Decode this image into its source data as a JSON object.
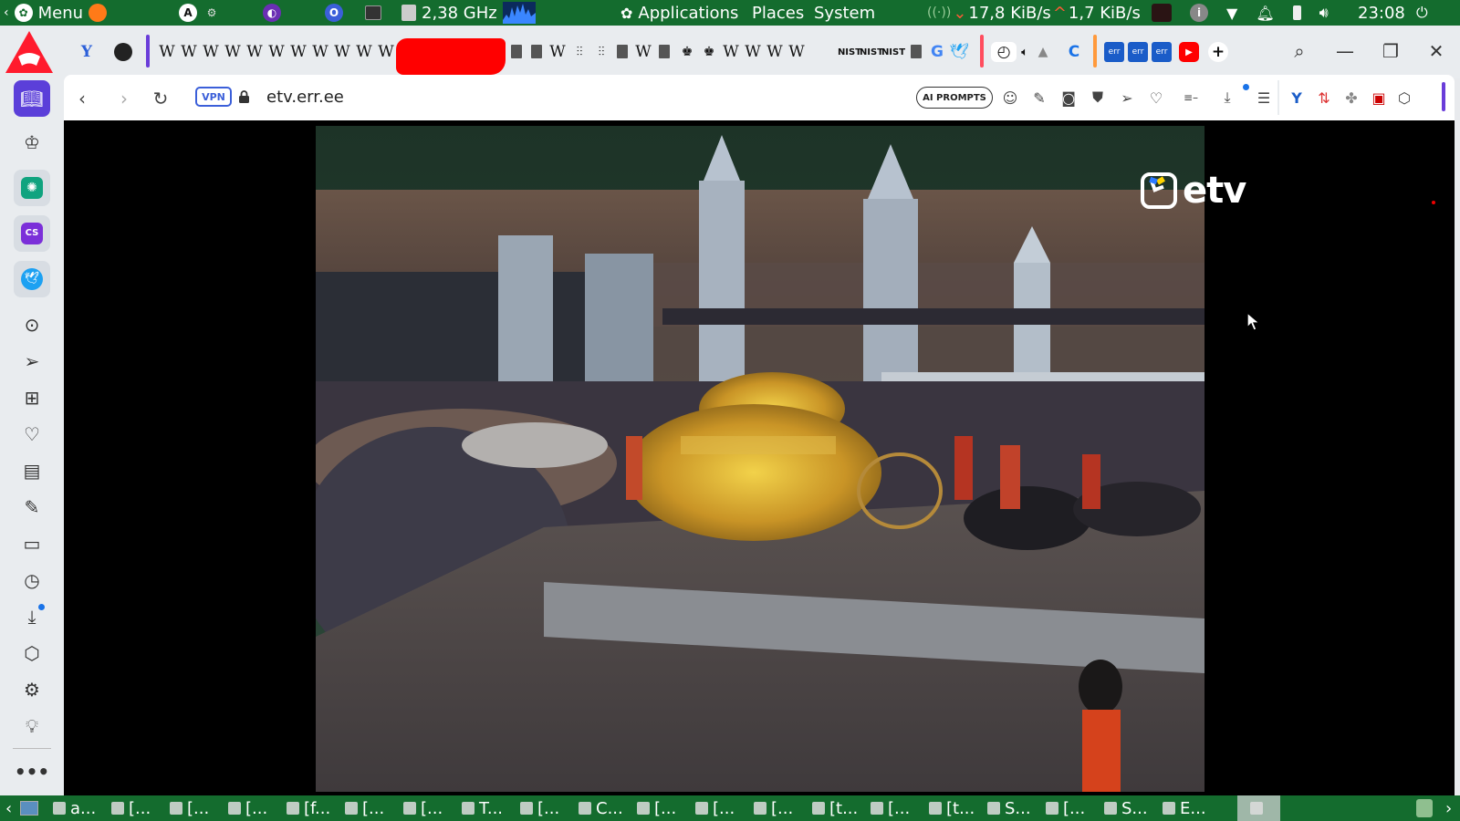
{
  "top_panel": {
    "menu_label": "Menu",
    "cpu_freq": "2,38 GHz",
    "applications": "Applications",
    "places": "Places",
    "system": "System",
    "net_down": "17,8 KiB/s",
    "net_up": "1,7 KiB/s",
    "clock": "23:08"
  },
  "tabs": {
    "wiki_letter": "W",
    "nist_label": "NIST"
  },
  "address_bar": {
    "vpn_label": "VPN",
    "url": "etv.err.ee",
    "ai_prompts_label": "AI PROMPTS"
  },
  "video": {
    "channel_logo_text": "etv"
  },
  "taskbar": {
    "items": [
      "a...",
      "[...",
      "[...",
      "[...",
      "[f...",
      "[...",
      "[...",
      "T...",
      "[...",
      "C...",
      "[...",
      "[...",
      "[...",
      "[t...",
      "[...",
      "[t...",
      "S...",
      "[...",
      "S...",
      "E...",
      ""
    ]
  },
  "colors": {
    "panel_green": "#146c2e",
    "opera_red": "#ff1b2d",
    "accent_blue": "#3b5fd9"
  }
}
